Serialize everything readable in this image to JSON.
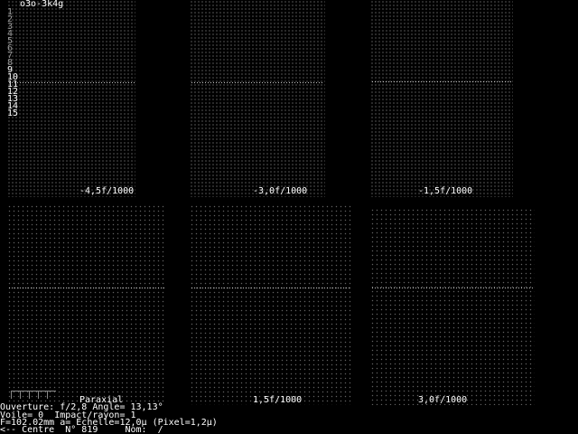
{
  "title": "o3o-3k4g",
  "ray_numbers": [
    "1",
    "2",
    "3",
    "4",
    "5",
    "6",
    "7",
    "8",
    "9",
    "10",
    "11",
    "12",
    "13",
    "14",
    "15"
  ],
  "panels": [
    {
      "label": "-4,5f/1000"
    },
    {
      "label": "-3,0f/1000"
    },
    {
      "label": "-1,5f/1000"
    },
    {
      "label": "Paraxial"
    },
    {
      "label": "1,5f/1000"
    },
    {
      "label": "3,0f/1000"
    }
  ],
  "status": {
    "line1": "Ouverture: f/2,8 Angle= 13,13°",
    "line2": "Voile= 0  Impact/rayon= 1",
    "line3": "F=102.02mm a= Echelle=12,0µ (Pixel=1,2µ)",
    "line4": "<-- Centre  N° 819     Nom: _/_"
  }
}
